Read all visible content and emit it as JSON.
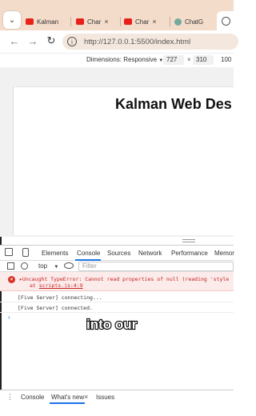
{
  "browser": {
    "tabs": [
      {
        "label": "Kalman",
        "icon": "youtube-icon"
      },
      {
        "label": "Char",
        "icon": "youtube-icon"
      },
      {
        "label": "Char",
        "icon": "youtube-icon"
      },
      {
        "label": "ChatG",
        "icon": "chatgpt-icon"
      }
    ],
    "url": "http://127.0.0.1:5500/index.html"
  },
  "device_toolbar": {
    "dimensions_label": "Dimensions: Responsive",
    "width": "727",
    "times": "×",
    "height": "310",
    "zoom": "100"
  },
  "page": {
    "heading": "Kalman Web Des"
  },
  "devtools": {
    "tabs": [
      "Elements",
      "Console",
      "Sources",
      "Network",
      "Performance",
      "Memor"
    ],
    "active_tab": "Console",
    "context": "top",
    "filter_placeholder": "Filter",
    "error_message": "Uncaught TypeError: Cannot read properties of null (reading 'style",
    "error_at": "at ",
    "error_link": "scripts.js:4:9",
    "logs": [
      "[Five Server] connecting...",
      "[Five Server] connected."
    ],
    "prompt": "›"
  },
  "caption": "into our",
  "drawer": {
    "tabs": [
      "Console",
      "What's new",
      "Issues"
    ],
    "close": "×"
  },
  "colors": {
    "tabbar": "#f4dccb",
    "accent": "#1a73e8",
    "error": "#c5221f"
  }
}
